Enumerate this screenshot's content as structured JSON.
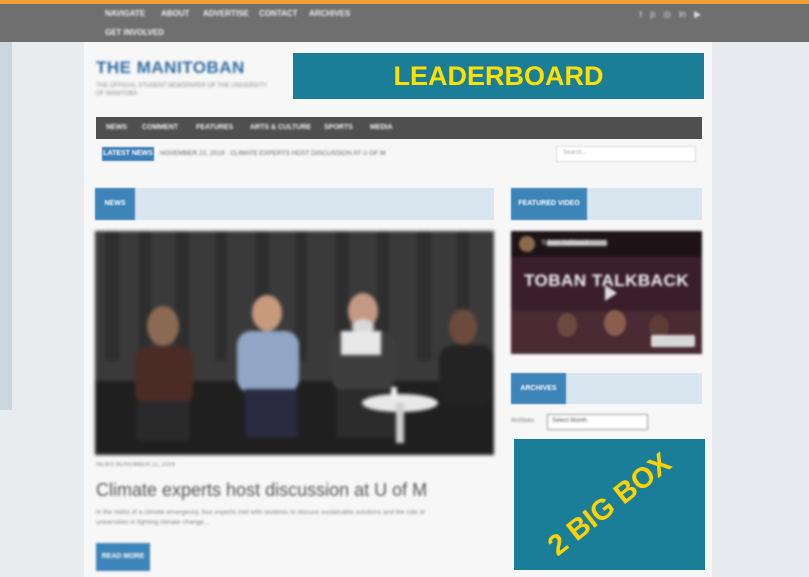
{
  "topbar": {
    "nav": [
      "NAVIGATE",
      "ABOUT",
      "ADVERTISE",
      "CONTACT",
      "ARCHIVES",
      "GET INVOLVED"
    ],
    "social_icons": [
      "twitter-icon",
      "pinterest-icon",
      "instagram-icon",
      "linkedin-icon",
      "youtube-icon"
    ]
  },
  "brand": {
    "name": "THE MANITOBAN",
    "tagline": "THE OFFICIAL STUDENT NEWSPAPER OF THE UNIVERSITY OF MANITOBA"
  },
  "ads": {
    "leaderboard": "LEADERBOARD",
    "bigbox": "2 BIG BOX"
  },
  "mainnav": [
    "NEWS",
    "COMMENT",
    "FEATURES",
    "ARTS & CULTURE",
    "SPORTS",
    "MEDIA"
  ],
  "ticker": {
    "badge": "LATEST NEWS",
    "text": "NOVEMBER 22, 2019 · CLIMATE EXPERTS HOST DISCUSSION AT U OF M",
    "search_placeholder": "Search..."
  },
  "sections": {
    "main": "NEWS",
    "video": "FEATURED VIDEO",
    "archive": "ARCHIVES"
  },
  "video": {
    "overlay": "TOBAN TALKBACK",
    "channel": "Toban Talkback"
  },
  "archive": {
    "label": "Archives",
    "selected": "Select Month"
  },
  "article": {
    "meta": "NEWS   NOVEMBER 22, 2019",
    "headline": "Climate experts host discussion at U of M",
    "excerpt": "In the midst of a climate emergency, four experts met with students to discuss sustainable solutions and the role of universities in fighting climate change...",
    "readmore": "READ MORE"
  },
  "colors": {
    "accent": "#f0a030",
    "ad_block": "#1b7e98",
    "ad_text": "#ffe000",
    "link_blue": "#3d84b8"
  }
}
